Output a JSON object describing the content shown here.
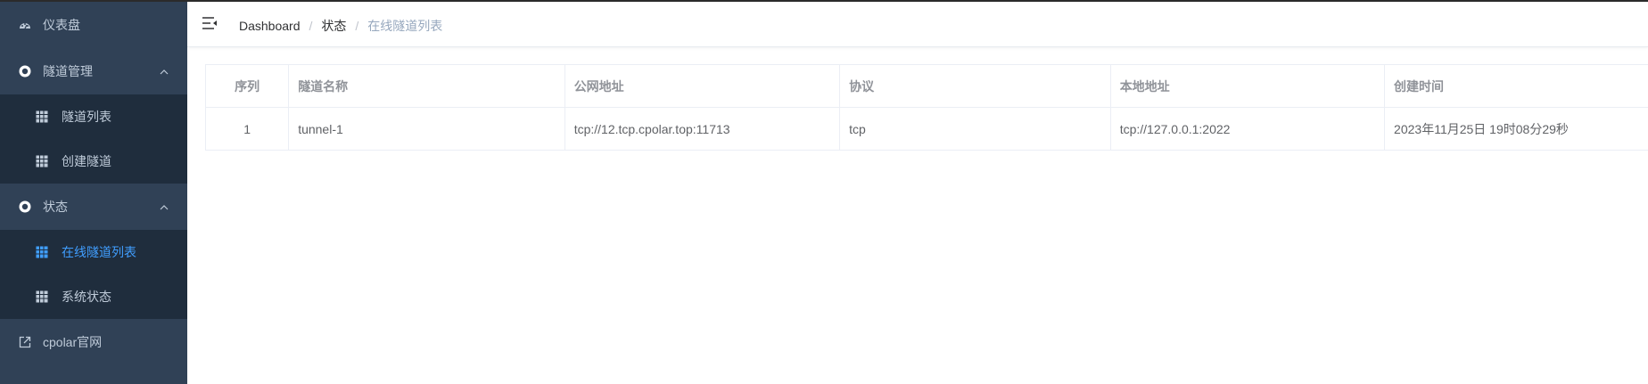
{
  "sidebar": {
    "dashboard": {
      "label": "仪表盘",
      "icon": "dashboard-icon"
    },
    "tunnel_mgmt": {
      "label": "隧道管理",
      "icon": "circle-plus-icon"
    },
    "tunnel_list": {
      "label": "隧道列表",
      "icon": "table-icon"
    },
    "create_tunnel": {
      "label": "创建隧道",
      "icon": "table-icon"
    },
    "status": {
      "label": "状态",
      "icon": "circle-plus-icon"
    },
    "online_tunnels": {
      "label": "在线隧道列表",
      "icon": "table-icon"
    },
    "system_status": {
      "label": "系统状态",
      "icon": "table-icon"
    },
    "website": {
      "label": "cpolar官网",
      "icon": "external-link-icon"
    }
  },
  "breadcrumb": {
    "items": [
      "Dashboard",
      "状态",
      "在线隧道列表"
    ],
    "separator": "/"
  },
  "table": {
    "headers": [
      "序列",
      "隧道名称",
      "公网地址",
      "协议",
      "本地地址",
      "创建时间"
    ],
    "rows": [
      [
        "1",
        "tunnel-1",
        "tcp://12.tcp.cpolar.top:11713",
        "tcp",
        "tcp://127.0.0.1:2022",
        "2023年11月25日 19时08分29秒"
      ]
    ]
  },
  "colors": {
    "sidebar_bg": "#304156",
    "submenu_bg": "#1f2d3d",
    "sidebar_text": "#bfcbd9",
    "active": "#409eff"
  }
}
